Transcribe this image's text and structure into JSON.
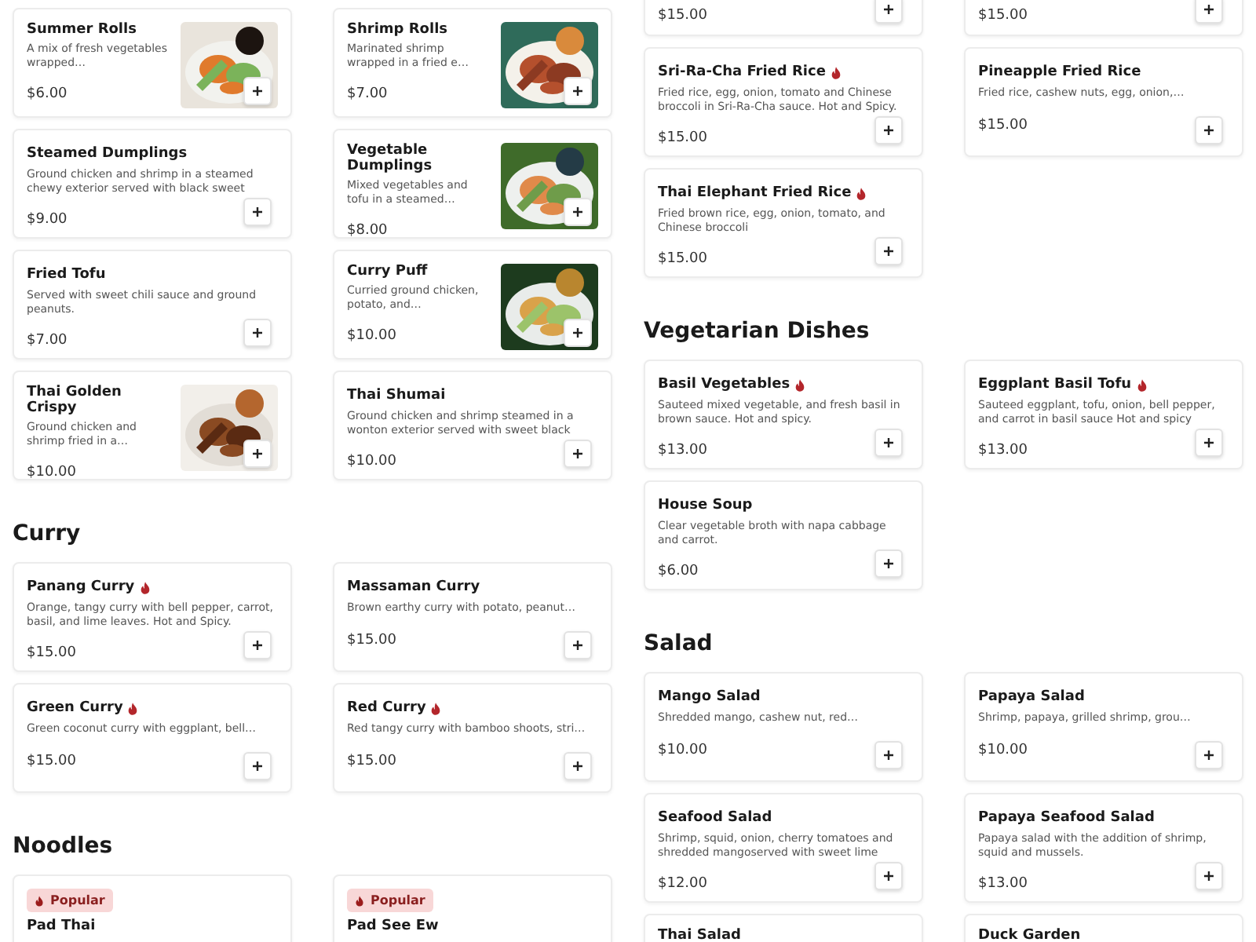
{
  "columns": [
    {
      "sections": [
        {
          "items": [
            {
              "kind": "picture",
              "name": "Summer Rolls",
              "description": "A mix of fresh vegetables wrapped…",
              "price": "$6.00"
            },
            {
              "kind": "picture",
              "name": "Shrimp Rolls",
              "description": "Marinated shrimp wrapped in a fried e…",
              "price": "$7.00"
            },
            {
              "kind": "plain",
              "name": "Steamed Dumplings",
              "description": "Ground chicken and shrimp in a steamed chewy exterior served with black sweet",
              "price": "$9.00"
            },
            {
              "kind": "picture",
              "name": "Vegetable Dumplings",
              "description": "Mixed vegetables and tofu in a steamed…",
              "price": "$8.00"
            },
            {
              "kind": "plain",
              "name": "Fried Tofu",
              "description": "Served with sweet chili sauce and ground peanuts.",
              "price": "$7.00"
            },
            {
              "kind": "picture",
              "name": "Curry Puff",
              "description": "Curried ground chicken, potato, and…",
              "price": "$10.00"
            },
            {
              "kind": "picture",
              "name": "Thai Golden Crispy",
              "description": "Ground chicken and shrimp fried in a…",
              "price": "$10.00"
            },
            {
              "kind": "plain",
              "name": "Thai Shumai",
              "description": "Ground chicken and shrimp steamed in a wonton exterior served with sweet black",
              "price": "$10.00"
            }
          ]
        },
        {
          "heading": "Curry",
          "items": [
            {
              "kind": "plain",
              "name": "Panang Curry",
              "spicy": true,
              "description": "Orange, tangy curry with bell pepper, carrot, basil, and lime leaves. Hot and Spicy.",
              "price": "$15.00"
            },
            {
              "kind": "plain",
              "name": "Massaman Curry",
              "description": "Brown earthy curry with potato, peanut…",
              "price": "$15.00"
            },
            {
              "kind": "plain",
              "name": "Green Curry",
              "spicy": true,
              "description": "Green coconut curry with eggplant, bell…",
              "price": "$15.00"
            },
            {
              "kind": "plain",
              "name": "Red Curry",
              "spicy": true,
              "description": "Red tangy curry with bamboo shoots, stri…",
              "price": "$15.00"
            }
          ]
        },
        {
          "heading": "Noodles",
          "items": [
            {
              "kind": "plain",
              "badge": "Popular",
              "name": "Pad Thai"
            },
            {
              "kind": "plain",
              "badge": "Popular",
              "name": "Pad See Ew"
            }
          ]
        }
      ]
    },
    {
      "sections": [
        {
          "items": [
            {
              "kind": "plain",
              "price": "$15.00"
            },
            {
              "kind": "plain",
              "price": "$15.00"
            },
            {
              "kind": "plain",
              "name": "Sri-Ra-Cha Fried Rice",
              "spicy": true,
              "description": "Fried rice, egg, onion, tomato and Chinese broccoli in Sri-Ra-Cha sauce. Hot and Spicy.",
              "price": "$15.00"
            },
            {
              "kind": "plain",
              "name": "Pineapple Fried Rice",
              "description": "Fried rice, cashew nuts, egg, onion,…",
              "price": "$15.00"
            },
            {
              "kind": "plain",
              "name": "Thai Elephant Fried Rice",
              "spicy": true,
              "description": "Fried brown rice, egg, onion, tomato, and Chinese broccoli",
              "price": "$15.00"
            }
          ]
        },
        {
          "heading": "Vegetarian Dishes",
          "items": [
            {
              "kind": "plain",
              "name": "Basil Vegetables",
              "spicy": true,
              "description": "Sauteed mixed vegetable, and fresh basil in brown sauce. Hot and spicy.",
              "price": "$13.00"
            },
            {
              "kind": "plain",
              "name": "Eggplant Basil Tofu",
              "spicy": true,
              "description": "Sauteed eggplant, tofu, onion, bell pepper, and carrot in basil sauce Hot and spicy",
              "price": "$13.00"
            },
            {
              "kind": "plain",
              "name": "House Soup",
              "description": "Clear vegetable broth with napa cabbage and carrot.",
              "price": "$6.00"
            }
          ]
        },
        {
          "heading": "Salad",
          "items": [
            {
              "kind": "plain",
              "name": "Mango Salad",
              "description": "Shredded mango, cashew nut, red…",
              "price": "$10.00"
            },
            {
              "kind": "plain",
              "name": "Papaya Salad",
              "description": "Shrimp, papaya, grilled shrimp, grou…",
              "price": "$10.00"
            },
            {
              "kind": "plain",
              "name": "Seafood Salad",
              "description": "Shrimp, squid, onion, cherry tomatoes and shredded mangoserved with sweet lime",
              "price": "$12.00"
            },
            {
              "kind": "plain",
              "name": "Papaya Seafood Salad",
              "description": "Papaya salad with the addition of shrimp, squid and mussels.",
              "price": "$13.00"
            },
            {
              "kind": "plain",
              "name": "Thai Salad"
            },
            {
              "kind": "plain",
              "name": "Duck Garden"
            }
          ]
        }
      ]
    }
  ]
}
